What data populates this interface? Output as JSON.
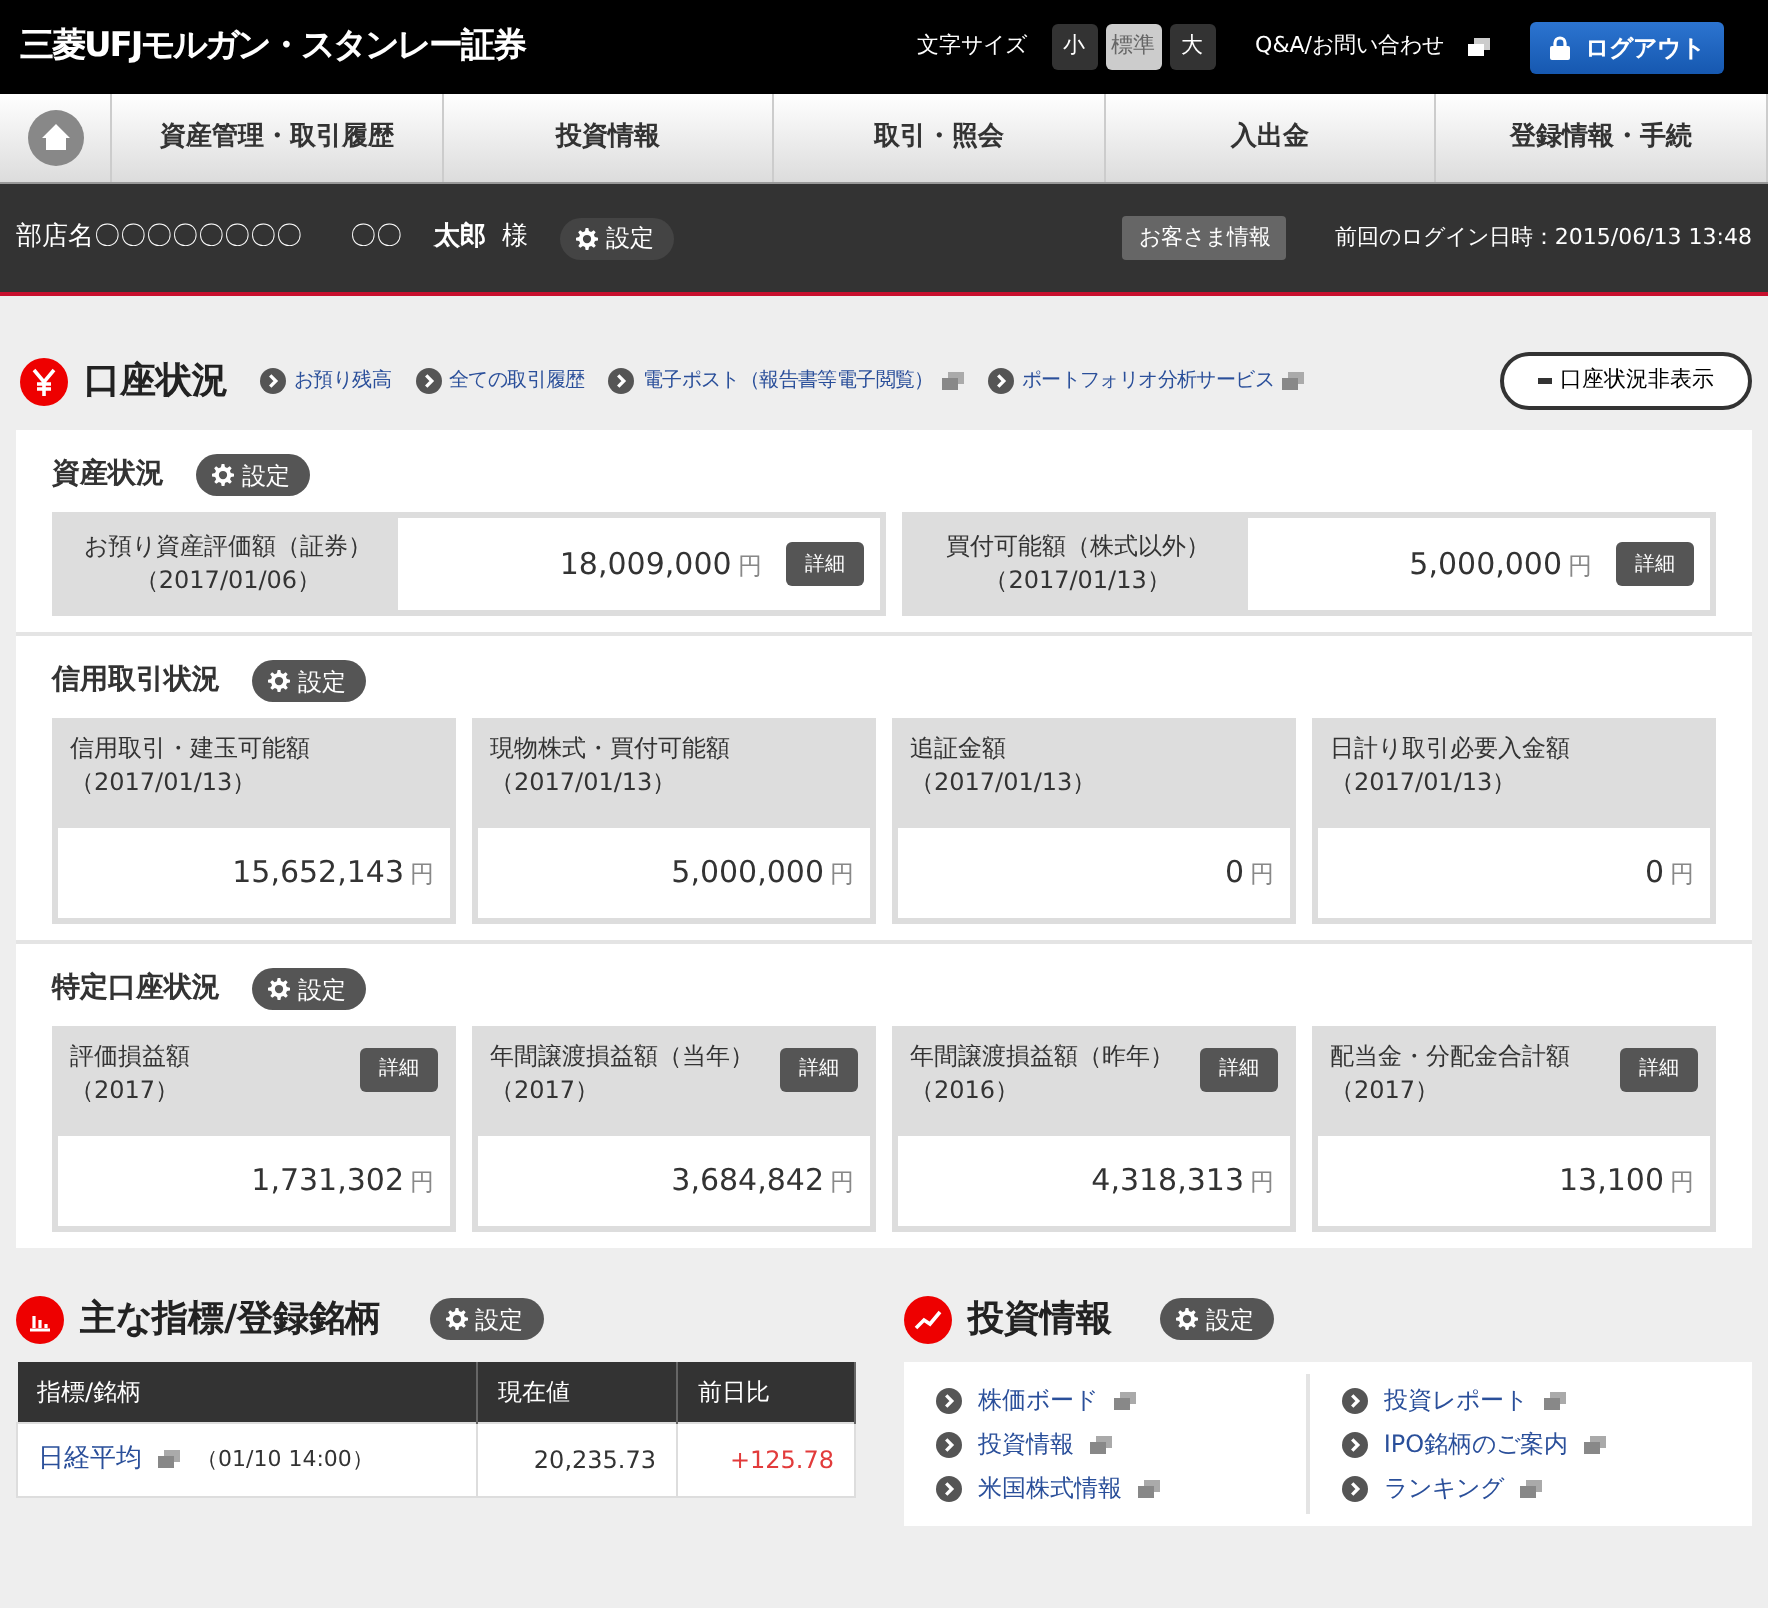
{
  "header": {
    "logo": "三菱UFJモルガン・スタンレー証券",
    "font_size_label": "文字サイズ",
    "font_sizes": [
      {
        "label": "小",
        "selected": false
      },
      {
        "label": "標準",
        "selected": true
      },
      {
        "label": "大",
        "selected": false
      }
    ],
    "help_link": "Q&A/お問い合わせ",
    "logout": "ログアウト"
  },
  "nav": {
    "items": [
      "資産管理・取引履歴",
      "投資情報",
      "取引・照会",
      "入出金",
      "登録情報・手続"
    ]
  },
  "user_bar": {
    "branch": "部店名〇〇〇〇〇〇〇〇",
    "family_name": "〇〇",
    "given_name": "太郎",
    "honorific": "様",
    "settings": "設定",
    "customer_info": "お客さま情報",
    "last_login": "前回のログイン日時：2015/06/13 13:48"
  },
  "account": {
    "title": "口座状況",
    "links": [
      {
        "label": "お預り残高",
        "external": false
      },
      {
        "label": "全ての取引履歴",
        "external": false
      },
      {
        "label": "電子ポスト（報告書等電子閲覧）",
        "external": true
      },
      {
        "label": "ポートフォリオ分析サービス",
        "external": true
      }
    ],
    "toggle": "口座状況非表示",
    "sections": [
      {
        "kind": "wide",
        "title": "資産状況",
        "settings": "設定",
        "cards": [
          {
            "label": "お預り資産評価額（証券）",
            "date": "（2017/01/06）",
            "value": "18,009,000",
            "unit": "円",
            "detail": "詳細"
          },
          {
            "label": "買付可能額（株式以外）",
            "date": "（2017/01/13）",
            "value": "5,000,000",
            "unit": "円",
            "detail": "詳細"
          }
        ]
      },
      {
        "kind": "grid",
        "title": "信用取引状況",
        "settings": "設定",
        "cards": [
          {
            "label": "信用取引・建玉可能額",
            "date": "（2017/01/13）",
            "value": "15,652,143",
            "unit": "円"
          },
          {
            "label": "現物株式・買付可能額",
            "date": "（2017/01/13）",
            "value": "5,000,000",
            "unit": "円"
          },
          {
            "label": "追証金額",
            "date": "（2017/01/13）",
            "value": "0",
            "unit": "円"
          },
          {
            "label": "日計り取引必要入金額",
            "date": "（2017/01/13）",
            "value": "0",
            "unit": "円"
          }
        ]
      },
      {
        "kind": "grid",
        "title": "特定口座状況",
        "settings": "設定",
        "cards": [
          {
            "label": "評価損益額",
            "date": "（2017）",
            "value": "1,731,302",
            "unit": "円",
            "detail": "詳細"
          },
          {
            "label": "年間譲渡損益額（当年）",
            "date": "（2017）",
            "value": "3,684,842",
            "unit": "円",
            "detail": "詳細"
          },
          {
            "label": "年間譲渡損益額（昨年）",
            "date": "（2016）",
            "value": "4,318,313",
            "unit": "円",
            "detail": "詳細"
          },
          {
            "label": "配当金・分配金合計額",
            "date": "（2017）",
            "value": "13,100",
            "unit": "円",
            "detail": "詳細"
          }
        ]
      }
    ]
  },
  "indices": {
    "title": "主な指標/登録銘柄",
    "settings": "設定",
    "columns": [
      "指標/銘柄",
      "現在値",
      "前日比"
    ],
    "rows": [
      {
        "name": "日経平均",
        "time": "（01/10 14:00）",
        "value": "20,235.73",
        "change": "+125.78"
      }
    ]
  },
  "investment": {
    "title": "投資情報",
    "settings": "設定",
    "columns": [
      [
        {
          "label": "株価ボード"
        },
        {
          "label": "投資情報"
        },
        {
          "label": "米国株式情報"
        }
      ],
      [
        {
          "label": "投資レポート"
        },
        {
          "label": "IPO銘柄のご案内"
        },
        {
          "label": "ランキング"
        }
      ]
    ]
  }
}
